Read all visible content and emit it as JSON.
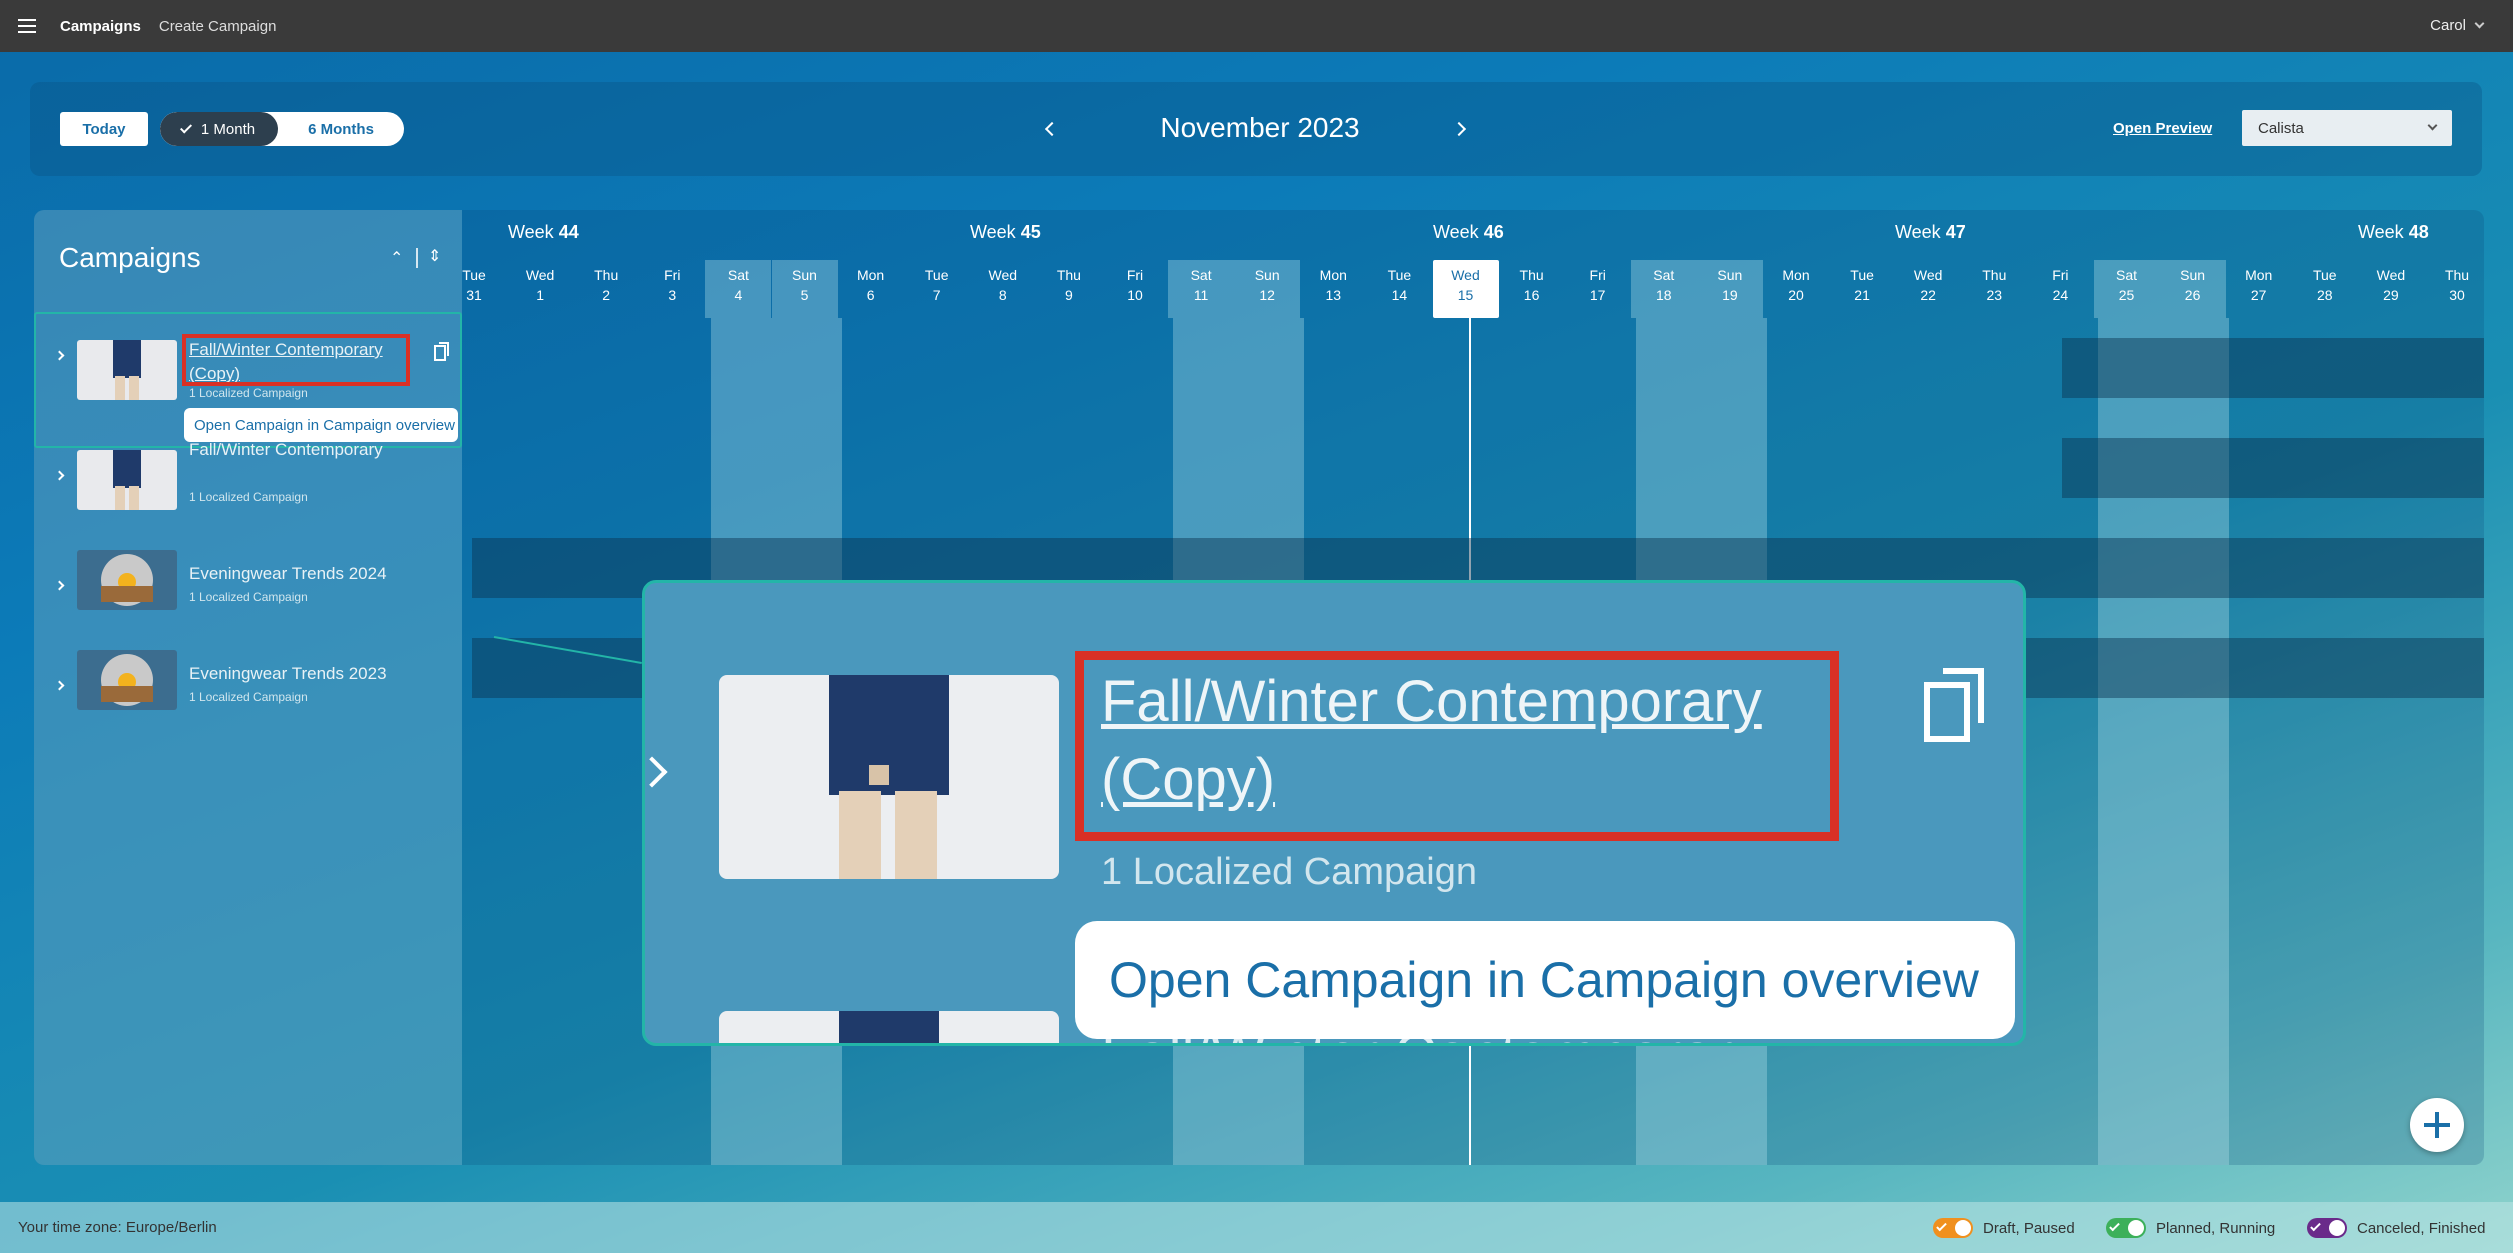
{
  "appbar": {
    "nav_campaigns": "Campaigns",
    "nav_create": "Create Campaign",
    "user": "Carol"
  },
  "toolbar": {
    "today": "Today",
    "range_1": "1 Month",
    "range_6": "6 Months",
    "month": "November 2023",
    "open_preview": "Open Preview",
    "select_value": "Calista"
  },
  "sidebar": {
    "title": "Campaigns",
    "rows": [
      {
        "title": "Fall/Winter Contemporary (Copy)",
        "sub": "1 Localized Campaign"
      },
      {
        "title": "Fall/Winter Contemporary",
        "sub": "1 Localized Campaign"
      },
      {
        "title": "Eveningwear Trends 2024",
        "sub": "1 Localized Campaign"
      },
      {
        "title": "Eveningwear Trends 2023",
        "sub": "1 Localized Campaign"
      }
    ],
    "tooltip": "Open Campaign in Campaign overview"
  },
  "calendar": {
    "weeks": [
      {
        "label": "Week",
        "num": "44"
      },
      {
        "label": "Week",
        "num": "45"
      },
      {
        "label": "Week",
        "num": "46"
      },
      {
        "label": "Week",
        "num": "47"
      },
      {
        "label": "Week",
        "num": "48"
      }
    ],
    "days": [
      [
        "Tue",
        "31"
      ],
      [
        "Wed",
        "1"
      ],
      [
        "Thu",
        "2"
      ],
      [
        "Fri",
        "3"
      ],
      [
        "Sat",
        "4"
      ],
      [
        "Sun",
        "5"
      ],
      [
        "Mon",
        "6"
      ],
      [
        "Tue",
        "7"
      ],
      [
        "Wed",
        "8"
      ],
      [
        "Thu",
        "9"
      ],
      [
        "Fri",
        "10"
      ],
      [
        "Sat",
        "11"
      ],
      [
        "Sun",
        "12"
      ],
      [
        "Mon",
        "13"
      ],
      [
        "Tue",
        "14"
      ],
      [
        "Wed",
        "15"
      ],
      [
        "Thu",
        "16"
      ],
      [
        "Fri",
        "17"
      ],
      [
        "Sat",
        "18"
      ],
      [
        "Sun",
        "19"
      ],
      [
        "Mon",
        "20"
      ],
      [
        "Tue",
        "21"
      ],
      [
        "Wed",
        "22"
      ],
      [
        "Thu",
        "23"
      ],
      [
        "Fri",
        "24"
      ],
      [
        "Sat",
        "25"
      ],
      [
        "Sun",
        "26"
      ],
      [
        "Mon",
        "27"
      ],
      [
        "Tue",
        "28"
      ],
      [
        "Wed",
        "29"
      ],
      [
        "Thu",
        "30"
      ]
    ]
  },
  "zoom": {
    "title": "Fall/Winter Contemporary (Copy)",
    "sub": "1 Localized Campaign",
    "tooltip": "Open Campaign in Campaign overview",
    "peek": "Fall/Winter Contemporary"
  },
  "footer": {
    "timezone": "Your time zone: Europe/Berlin",
    "legend": [
      {
        "label": "Draft, Paused",
        "color": "#f0901e"
      },
      {
        "label": "Planned, Running",
        "color": "#3cb05a"
      },
      {
        "label": "Canceled, Finished",
        "color": "#6a2a8a"
      }
    ]
  },
  "colors": {
    "accent": "#1a6fa8",
    "highlight": "#d93025",
    "selection": "#23b5a8"
  }
}
